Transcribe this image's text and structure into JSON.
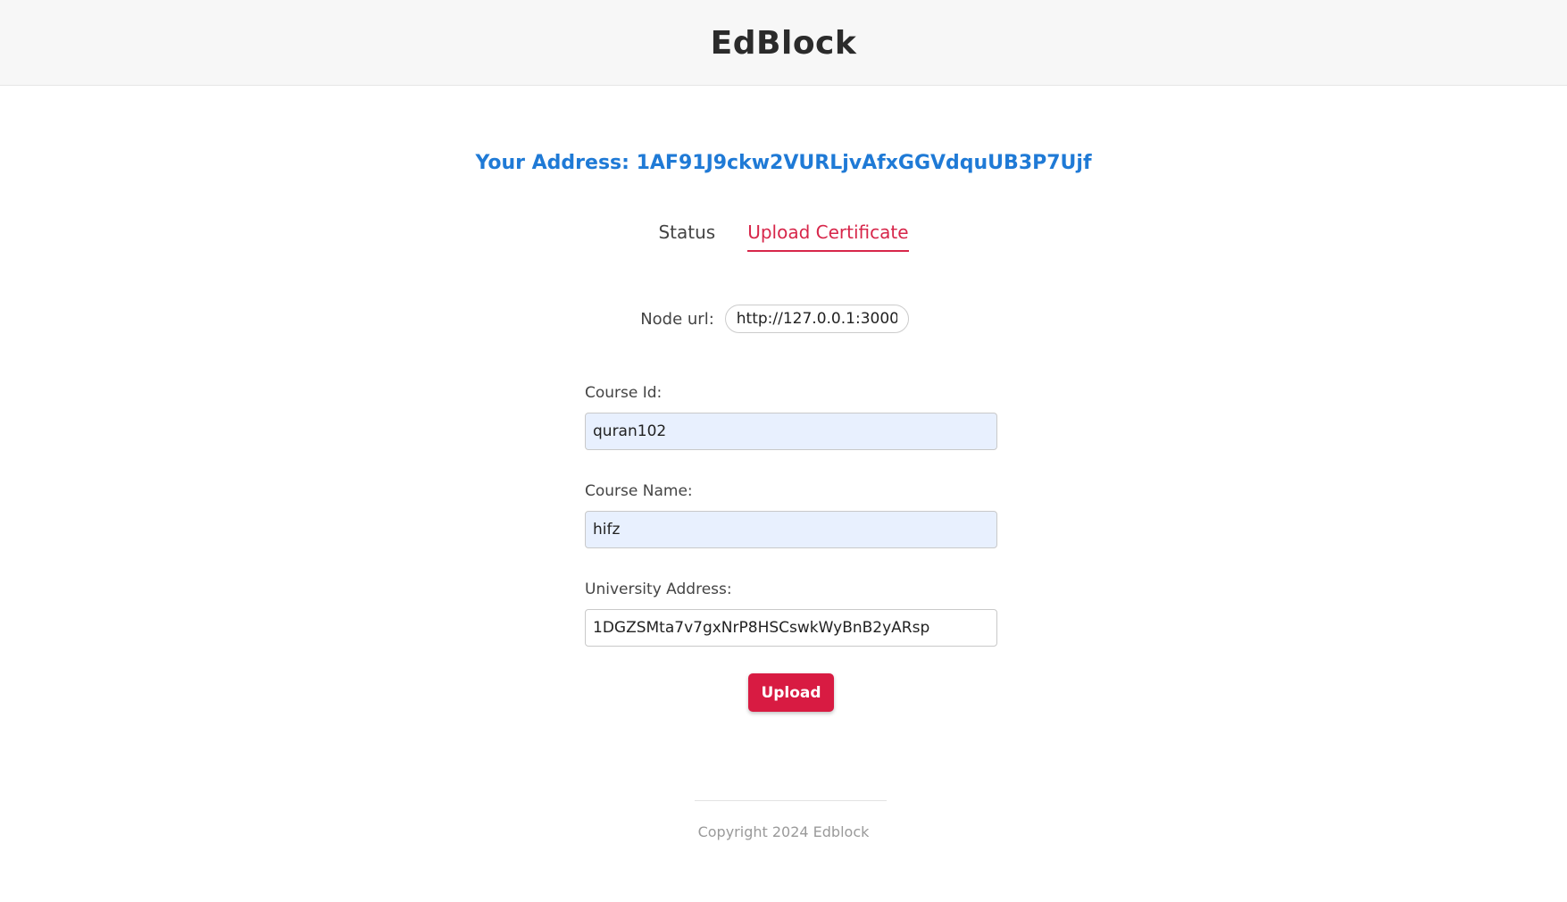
{
  "header": {
    "title": "EdBlock"
  },
  "account": {
    "address_text": "Your Address: 1AF91J9ckw2VURLjvAfxGGVdquUB3P7Ujf"
  },
  "tabs": [
    {
      "label": "Status",
      "active": false
    },
    {
      "label": "Upload Certificate",
      "active": true
    }
  ],
  "node": {
    "label": "Node url:",
    "value": "http://127.0.0.1:3000"
  },
  "form": {
    "course_id": {
      "label": "Course Id:",
      "value": "quran102"
    },
    "course_name": {
      "label": "Course Name:",
      "value": "hifz"
    },
    "university_address": {
      "label": "University Address:",
      "value": "1DGZSMta7v7gxNrP8HSCswkWyBnB2yARsp"
    },
    "submit_label": "Upload"
  },
  "footer": {
    "copyright": "Copyright 2024 Edblock"
  },
  "colors": {
    "accent": "#d81b42",
    "address_blue": "#1f7ad6",
    "autofill_bg": "#e8f0fe"
  }
}
